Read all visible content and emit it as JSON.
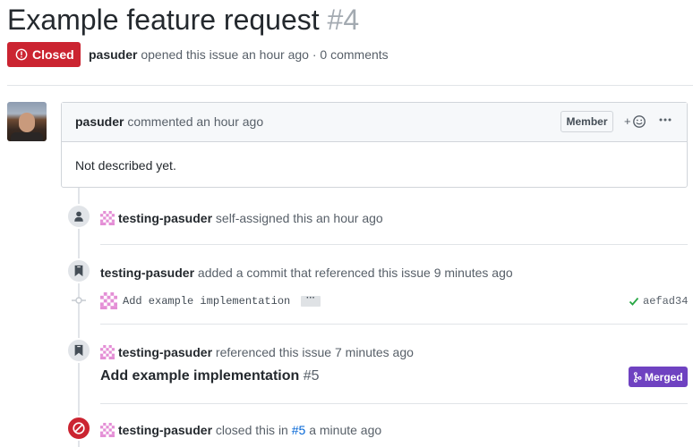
{
  "issue": {
    "title": "Example feature request",
    "number": "#4",
    "state": "Closed",
    "author": "pasuder",
    "meta_text": "opened this issue an hour ago",
    "dot": "·",
    "comments": "0 comments"
  },
  "comment": {
    "author": "pasuder",
    "action": "commented an hour ago",
    "role": "Member",
    "reaction": "+☺",
    "more": "···",
    "body": "Not described yet."
  },
  "events": [
    {
      "actor": "testing-pasuder",
      "text": "self-assigned this an hour ago",
      "icon": "person-icon"
    },
    {
      "actor": "testing-pasuder",
      "text": "added a commit that referenced this issue 9 minutes ago",
      "icon": "bookmark-icon",
      "commit_message": "Add example implementation",
      "commit_more": "···",
      "commit_sha": "aefad34"
    },
    {
      "actor": "testing-pasuder",
      "text": "referenced this issue 7 minutes ago",
      "icon": "bookmark-icon",
      "ref_title": "Add example implementation",
      "ref_number": "#5",
      "ref_state": "Merged"
    },
    {
      "actor": "testing-pasuder",
      "text_before": "closed this in",
      "link": "#5",
      "text_after": "a minute ago",
      "icon": "circle-slash-icon"
    }
  ],
  "colors": {
    "closed": "#cb2431",
    "merged": "#6f42c1",
    "link": "#0366d6",
    "success": "#28a745"
  }
}
